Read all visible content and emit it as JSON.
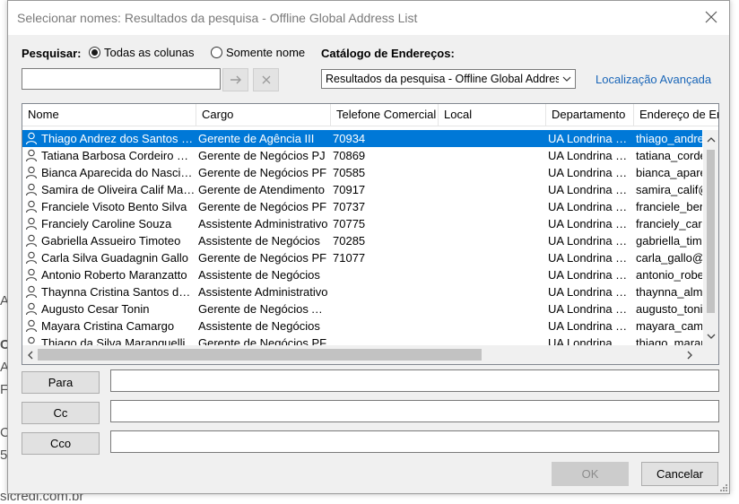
{
  "background": {
    "fragments": [
      "A",
      "Ci",
      "Ar",
      "Fo",
      "Ce",
      "5",
      "sicredi.com.br"
    ]
  },
  "dialog": {
    "title": "Selecionar nomes: Resultados da pesquisa - Offline Global Address List"
  },
  "search": {
    "label": "Pesquisar:",
    "option_all": "Todas as colunas",
    "option_name": "Somente nome",
    "selected_option": "Todas as colunas",
    "value": "",
    "go_icon": "arrow-right-icon",
    "clear_icon": "close-icon"
  },
  "catalog": {
    "label": "Catálogo de Endereços:",
    "value": "Resultados da pesquisa - Offline Global Address List",
    "advanced_link": "Localização Avançada"
  },
  "table": {
    "columns": [
      "Nome",
      "Cargo",
      "Telefone Comercial",
      "Local",
      "Departamento",
      "Endereço de Email"
    ],
    "selected_row": 0,
    "rows": [
      {
        "nome": "Thiago Andrez dos Santos Silva",
        "cargo": "Gerente de Agência III",
        "telefone": "70934",
        "local": "",
        "departamento": "UA Londrina Dez de Dezembro",
        "email": "thiago_andrez@sicredi.com.br"
      },
      {
        "nome": "Tatiana Barbosa Cordeiro Soares",
        "cargo": "Gerente de Negócios PJ",
        "telefone": "70869",
        "local": "",
        "departamento": "UA Londrina Dez de Dezembro",
        "email": "tatiana_cordeiro@sicredi.com.br"
      },
      {
        "nome": "Bianca Aparecida do Nascimento",
        "cargo": "Gerente de Negócios PF",
        "telefone": "70585",
        "local": "",
        "departamento": "UA Londrina Dez de Dezembro",
        "email": "bianca_aparecida@sicredi.com.br"
      },
      {
        "nome": "Samira de Oliveira Calif Martins",
        "cargo": "Gerente de Atendimento",
        "telefone": "70917",
        "local": "",
        "departamento": "UA Londrina Dez de Dezembro",
        "email": "samira_calif@sicredi.com.br"
      },
      {
        "nome": "Franciele Visoto Bento Silva",
        "cargo": "Gerente de Negócios PF",
        "telefone": "70737",
        "local": "",
        "departamento": "UA Londrina Dez de Dezembro",
        "email": "franciele_bento@sicredi.com.br"
      },
      {
        "nome": "Franciely Caroline Souza",
        "cargo": "Assistente Administrativo",
        "telefone": "70775",
        "local": "",
        "departamento": "UA Londrina Dez de Dezembro",
        "email": "franciely_caroline@sicredi.com.br"
      },
      {
        "nome": "Gabriella Assueiro Timoteo",
        "cargo": "Assistente de Negócios",
        "telefone": "70285",
        "local": "",
        "departamento": "UA Londrina Dez de Dezembro",
        "email": "gabriella_timoteo@sicredi.com.br"
      },
      {
        "nome": "Carla Silva Guadagnin Gallo",
        "cargo": "Gerente de Negócios PF",
        "telefone": "71077",
        "local": "",
        "departamento": "UA Londrina Dez de Dezembro",
        "email": "carla_gallo@sicredi.com.br"
      },
      {
        "nome": "Antonio Roberto Maranzatto",
        "cargo": "Assistente de Negócios",
        "telefone": "",
        "local": "",
        "departamento": "UA Londrina Dez de Dezembro",
        "email": "antonio_roberto@sicredi.com.br"
      },
      {
        "nome": "Thaynna Cristina Santos de Almeida",
        "cargo": "Assistente Administrativo",
        "telefone": "",
        "local": "",
        "departamento": "UA Londrina Dez de Dezembro",
        "email": "thaynna_almeida@sicredi.com.br"
      },
      {
        "nome": "Augusto Cesar Tonin",
        "cargo": "Gerente de Negócios Agro",
        "telefone": "",
        "local": "",
        "departamento": "UA Londrina Dez de Dezembro",
        "email": "augusto_tonin@sicredi.com.br"
      },
      {
        "nome": "Mayara Cristina Camargo",
        "cargo": "Assistente de Negócios",
        "telefone": "",
        "local": "",
        "departamento": "UA Londrina Dez de Dezembro",
        "email": "mayara_camargo@sicredi.com.br"
      },
      {
        "nome": "Thiago da Silva Maranguelli",
        "cargo": "Gerente de Negócios PF",
        "telefone": "",
        "local": "",
        "departamento": "UA Londrina Dez de Dezembro",
        "email": "thiago_maranguelli@sicredi.com.br"
      }
    ]
  },
  "recipients": {
    "para": {
      "label": "Para",
      "value": ""
    },
    "cc": {
      "label": "Cc",
      "value": ""
    },
    "cco": {
      "label": "Cco",
      "value": ""
    }
  },
  "buttons": {
    "ok": "OK",
    "cancel": "Cancelar"
  },
  "colors": {
    "selection": "#0078d7",
    "link": "#1a66b8",
    "dialog_bg": "#f0f0f0"
  }
}
